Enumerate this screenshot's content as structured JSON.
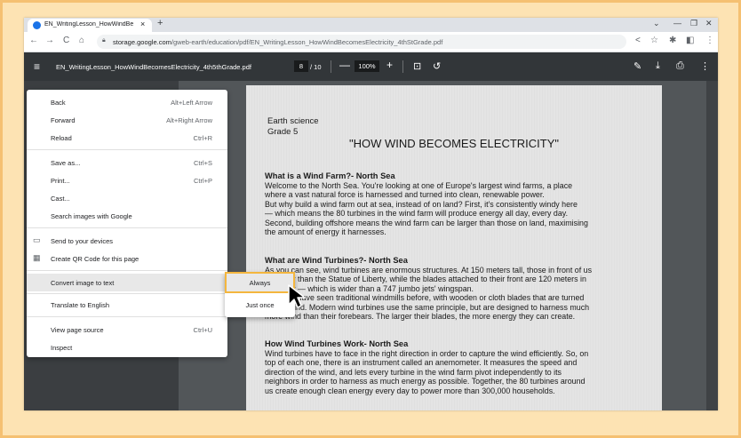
{
  "tab": {
    "title": "EN_WritingLesson_HowWindBe",
    "close": "×",
    "new_tab": "+"
  },
  "window_controls": {
    "dropdown": "⌄",
    "minimize": "—",
    "restore": "❐",
    "close": "✕"
  },
  "toolbar": {
    "back": "←",
    "forward": "→",
    "reload": "C",
    "home": "⌂",
    "url_host": "storage.google.com",
    "url_path": "/gweb-earth/education/pdf/EN_WritingLesson_HowWindBecomesElectricity_4thStGrade.pdf",
    "share": "<",
    "bookmark": "☆",
    "extensions": "✱",
    "sidepanel": "◧",
    "more": "⋮"
  },
  "pdf_toolbar": {
    "menu": "≡",
    "filename": "EN_WritingLesson_HowWindBecomesElectricity_4th5thGrade.pdf",
    "page_current": "8",
    "page_total": "/ 10",
    "zoom_out": "—",
    "zoom": "100%",
    "zoom_in": "+",
    "fit": "⊡",
    "rotate": "↺",
    "annotate": "✎",
    "download": "⤓",
    "print": "⎙",
    "more": "⋮"
  },
  "document": {
    "subject": "Earth science",
    "grade": "Grade 5",
    "title": "\"HOW WIND BECOMES ELECTRICITY\"",
    "sections": [
      {
        "heading": "What is a Wind Farm?- North Sea",
        "lines": [
          "Welcome to the North Sea. You're looking at one of Europe's largest wind farms, a place",
          "where a vast natural force is harnessed and turned into clean, renewable power.",
          "But why build a wind farm out at sea, instead of on land? First, it's consistently windy here",
          "— which means the 80 turbines in the wind farm will produce energy all day, every day.",
          "Second, building offshore means the wind farm can be larger than those on land, maximising",
          "the amount of energy it harnesses."
        ]
      },
      {
        "heading": "What are Wind Turbines?- North Sea",
        "lines": [
          "As you can see, wind turbines are enormous structures. At 150 meters tall, those in front of us",
          "are taller than the Statue of Liberty, while the blades attached to their front are 120 meters in",
          "diameter — which is wider than a 747 jumbo jets' wingspan.",
          "You may have seen traditional windmills before, with wooden or cloth blades that are turned",
          "by the wind. Modern wind turbines use the same principle, but are designed to harness much",
          "more wind than their forebears. The larger their blades, the more energy they can create."
        ]
      },
      {
        "heading": "How Wind Turbines Work- North Sea",
        "lines": [
          "Wind turbines have to face in the right direction in order to capture the wind efficiently. So, on",
          "top of each one, there is an instrument called an anemometer. It measures the speed and",
          "direction of the wind, and lets every turbine in the wind farm pivot independently to its",
          "neighbors in order to harness as much energy as possible. Together, the 80 turbines around",
          "us create enough clean energy every day to power more than 300,000 households."
        ]
      }
    ]
  },
  "context_menu": {
    "items": [
      {
        "label": "Back",
        "shortcut": "Alt+Left Arrow"
      },
      {
        "label": "Forward",
        "shortcut": "Alt+Right Arrow"
      },
      {
        "label": "Reload",
        "shortcut": "Ctrl+R"
      },
      {
        "label": "Save as...",
        "shortcut": "Ctrl+S"
      },
      {
        "label": "Print...",
        "shortcut": "Ctrl+P"
      },
      {
        "label": "Cast...",
        "shortcut": ""
      },
      {
        "label": "Search images with Google",
        "shortcut": ""
      },
      {
        "label": "Send to your devices",
        "shortcut": ""
      },
      {
        "label": "Create QR Code for this page",
        "shortcut": ""
      },
      {
        "label": "Convert image to text",
        "shortcut": ""
      },
      {
        "label": "Translate to English",
        "shortcut": ""
      },
      {
        "label": "View page source",
        "shortcut": "Ctrl+U"
      },
      {
        "label": "Inspect",
        "shortcut": ""
      }
    ]
  },
  "submenu": {
    "always": "Always",
    "just_once": "Just once"
  },
  "colors": {
    "highlight_border": "#f4b63e",
    "pdf_toolbar": "#323639",
    "viewer_bg": "#525659"
  }
}
